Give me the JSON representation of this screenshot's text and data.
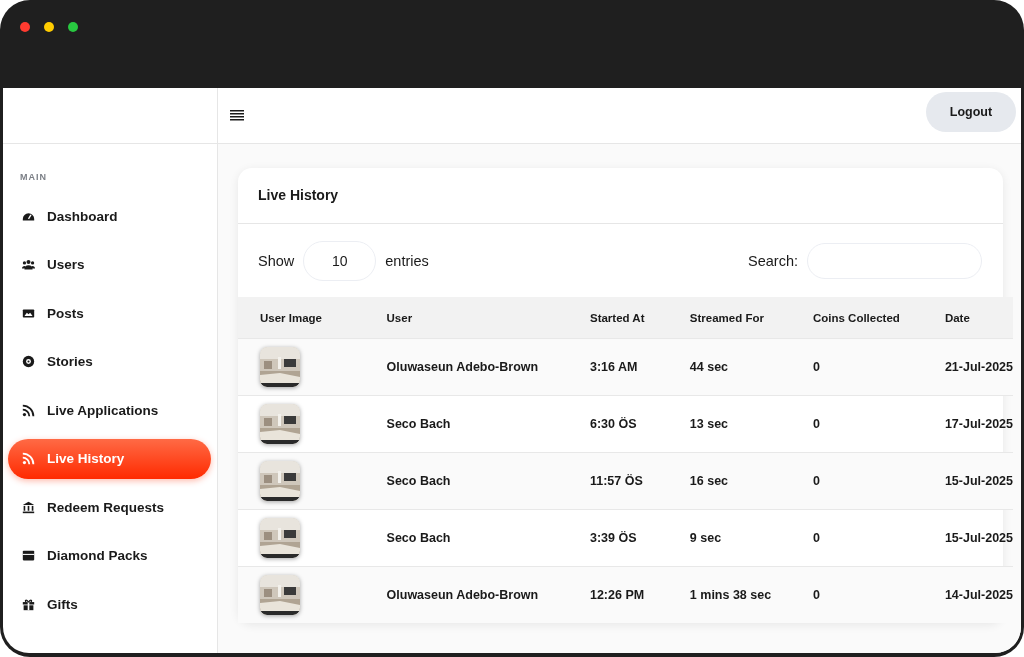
{
  "sidebar": {
    "section_label": "MAIN",
    "items": [
      {
        "label": "Dashboard",
        "selected": false
      },
      {
        "label": "Users",
        "selected": false
      },
      {
        "label": "Posts",
        "selected": false
      },
      {
        "label": "Stories",
        "selected": false
      },
      {
        "label": "Live Applications",
        "selected": false
      },
      {
        "label": "Live History",
        "selected": true
      },
      {
        "label": "Redeem Requests",
        "selected": false
      },
      {
        "label": "Diamond Packs",
        "selected": false
      },
      {
        "label": "Gifts",
        "selected": false
      }
    ]
  },
  "header": {
    "logout": "Logout"
  },
  "card": {
    "title": "Live History",
    "show_label": "Show",
    "page_size": "10",
    "entries_label": "entries",
    "search_label": "Search:"
  },
  "table": {
    "columns": [
      "User Image",
      "User",
      "Started At",
      "Streamed For",
      "Coins Collected",
      "Date"
    ],
    "rows": [
      {
        "user": "Oluwaseun Adebo-Brown",
        "started_at": "3:16 AM",
        "streamed_for": "44 sec",
        "coins_collected": "0",
        "date": "21-Jul-2025"
      },
      {
        "user": "Seco Bach",
        "started_at": "6:30 ÖS",
        "streamed_for": "13 sec",
        "coins_collected": "0",
        "date": "17-Jul-2025"
      },
      {
        "user": "Seco Bach",
        "started_at": "11:57 ÖS",
        "streamed_for": "16 sec",
        "coins_collected": "0",
        "date": "15-Jul-2025"
      },
      {
        "user": "Seco Bach",
        "started_at": "3:39 ÖS",
        "streamed_for": "9 sec",
        "coins_collected": "0",
        "date": "15-Jul-2025"
      },
      {
        "user": "Oluwaseun Adebo-Brown",
        "started_at": "12:26 PM",
        "streamed_for": "1 mins 38 sec",
        "coins_collected": "0",
        "date": "14-Jul-2025"
      }
    ]
  }
}
